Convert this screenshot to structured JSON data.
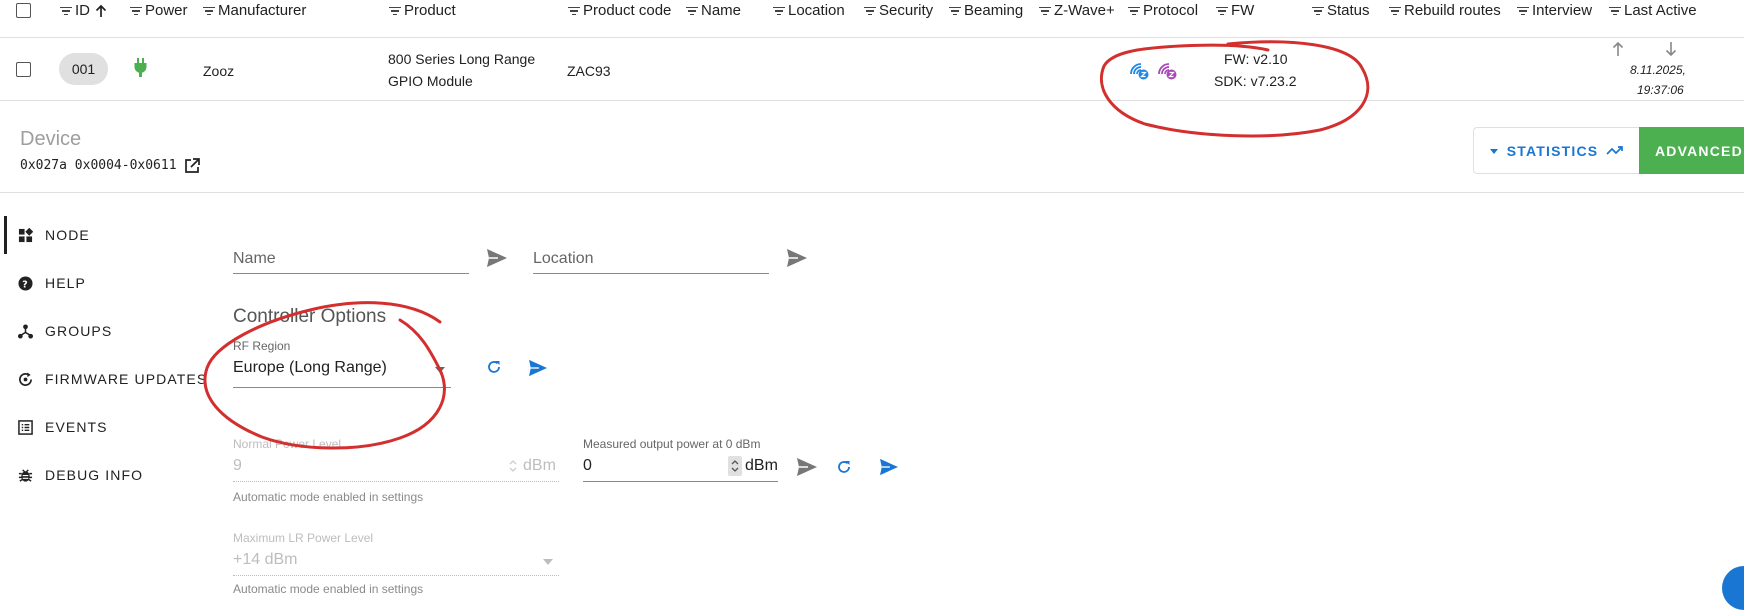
{
  "table": {
    "columns": [
      "ID",
      "Power",
      "Manufacturer",
      "Product",
      "Product code",
      "Name",
      "Location",
      "Security",
      "Beaming",
      "Z-Wave+",
      "Protocol",
      "FW",
      "Status",
      "Rebuild routes",
      "Interview",
      "Last Active"
    ],
    "row": {
      "id": "001",
      "manufacturer": "Zooz",
      "product_line1": "800 Series Long Range",
      "product_line2": "GPIO Module",
      "product_code": "ZAC93",
      "fw": "FW: v2.10",
      "sdk": "SDK: v7.23.2",
      "last_active_date": "8.11.2025,",
      "last_active_time": "19:37:06"
    }
  },
  "device": {
    "title": "Device",
    "ids": "0x027a 0x0004-0x0611"
  },
  "buttons": {
    "statistics": "STATISTICS",
    "advanced": "ADVANCED"
  },
  "sidebar": {
    "items": [
      {
        "label": "NODE"
      },
      {
        "label": "HELP"
      },
      {
        "label": "GROUPS"
      },
      {
        "label": "FIRMWARE UPDATES"
      },
      {
        "label": "EVENTS"
      },
      {
        "label": "DEBUG INFO"
      }
    ]
  },
  "form": {
    "name_placeholder": "Name",
    "location_placeholder": "Location",
    "section_title": "Controller Options",
    "rf_region_label": "RF Region",
    "rf_region_value": "Europe (Long Range)",
    "normal_power_label": "Normal Power Level",
    "normal_power_value": "9",
    "normal_power_unit": "dBm",
    "measured_power_label": "Measured output power at 0 dBm",
    "measured_power_value": "0",
    "measured_power_unit": "dBm",
    "auto_hint": "Automatic mode enabled in settings",
    "max_lr_label": "Maximum LR Power Level",
    "max_lr_value": "+14 dBm",
    "auto_hint2": "Automatic mode enabled in settings"
  },
  "colors": {
    "accent": "#1976d2",
    "advanced": "#4caf50",
    "power": "#4caf50",
    "annotation": "#d32f2f",
    "protocol_zwave": "#1e88e5",
    "protocol_lr": "#ab47bc"
  }
}
